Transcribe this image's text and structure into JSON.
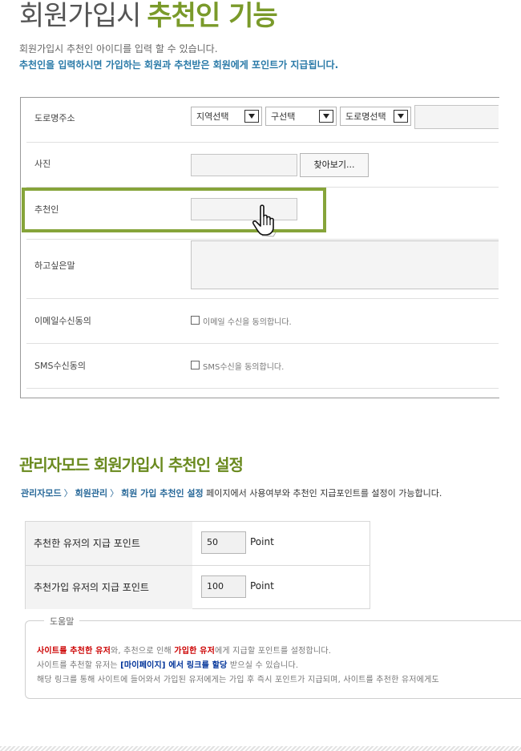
{
  "header": {
    "title_plain": "회원가입시",
    "title_highlight": "추천인 기능",
    "desc1": "회원가입시 추천인 아이디를 입력 할 수 있습니다.",
    "desc2": "추천인을 입력하시면 가입하는 회원과 추천받은 회원에게 포인트가 지급됩니다."
  },
  "form": {
    "rows": [
      {
        "label": "도로명주소"
      },
      {
        "label": "사진"
      },
      {
        "label": "추천인"
      },
      {
        "label": "하고싶은말"
      },
      {
        "label": "이메일수신동의"
      },
      {
        "label": "SMS수신동의"
      }
    ],
    "address": {
      "select_region": "지역선택",
      "select_district": "구선택",
      "select_road": "도로명선택"
    },
    "browse_button": "찾아보기...",
    "email_consent": "이메일 수신을 동의합니다.",
    "sms_consent": "SMS수신을 동의합니다."
  },
  "admin": {
    "title": "관리자모드 회원가입시 추천인 설정",
    "breadcrumb": [
      "관리자모드",
      "회원관리",
      "회원 가입 추천인 설정"
    ],
    "breadcrumb_sep": "〉",
    "breadcrumb_tail": " 페이지에서 사용여부와 추천인 지급포인트를 설정이 가능합니다.",
    "settings": [
      {
        "label": "추천한 유저의 지급 포인트",
        "value": "50",
        "unit": "Point"
      },
      {
        "label": "추천가입 유저의 지급 포인트",
        "value": "100",
        "unit": "Point"
      }
    ],
    "help": {
      "legend": "도움말",
      "line1_a": "사이트를 추천한 유저",
      "line1_b": "와, 추천으로 인해 ",
      "line1_c": "가입한 유저",
      "line1_d": "에게 지급할 포인트를 설정합니다.",
      "line2_a": "사이트를 추천할 유저는 ",
      "line2_b": "[마이페이지] 에서 링크를 할당",
      "line2_c": " 받으실 수 있습니다.",
      "line3": "해당 링크를 통해 사이트에 들어와서 가입된 유저에게는 가입 후 즉시 포인트가 지급되며, 사이트를 추천한 유저에게도"
    }
  },
  "colors": {
    "title_green": "#7a9a2a",
    "desc_blue": "#2a7aa8",
    "highlight_border": "#86a43a",
    "help_red": "#cc0000",
    "help_blue": "#003399"
  }
}
